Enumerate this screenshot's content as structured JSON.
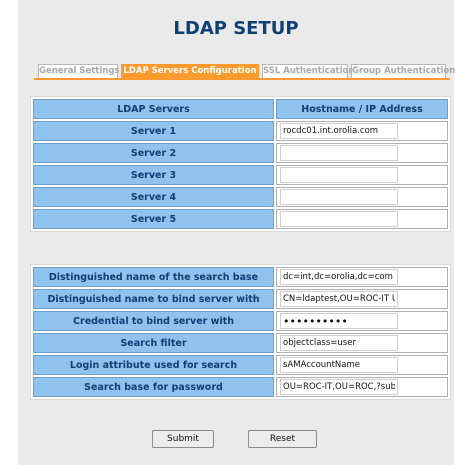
{
  "page": {
    "title": "LDAP SETUP"
  },
  "tabs": [
    {
      "label": "General Settings",
      "active": false
    },
    {
      "label": "LDAP Servers Configuration",
      "active": true
    },
    {
      "label": "SSL Authentication",
      "active": false
    },
    {
      "label": "Group Authentication",
      "active": false
    }
  ],
  "servers": {
    "header_name": "LDAP Servers",
    "header_address": "Hostname / IP Address",
    "rows": [
      {
        "label": "Server 1",
        "value": "rocdc01.int.orolia.com"
      },
      {
        "label": "Server 2",
        "value": ""
      },
      {
        "label": "Server 3",
        "value": ""
      },
      {
        "label": "Server 4",
        "value": ""
      },
      {
        "label": "Server 5",
        "value": ""
      }
    ]
  },
  "settings": {
    "rows": [
      {
        "label": "Distinguished name of the search base",
        "value": "dc=int,dc=orolia,dc=com"
      },
      {
        "label": "Distinguished name to bind server with",
        "value": "CN=ldaptest,OU=ROC-IT U"
      },
      {
        "label": "Credential to bind server with",
        "value": "••••••••••"
      },
      {
        "label": "Search filter",
        "value": "objectclass=user"
      },
      {
        "label": "Login attribute used for search",
        "value": "sAMAccountName"
      },
      {
        "label": "Search base for password",
        "value": "OU=ROC-IT,OU=ROC,?sub"
      }
    ]
  },
  "buttons": {
    "submit": "Submit",
    "reset": "Reset"
  },
  "colors": {
    "title": "#103f73",
    "accent": "#fe9a2e",
    "cell": "#8fc3ee"
  }
}
